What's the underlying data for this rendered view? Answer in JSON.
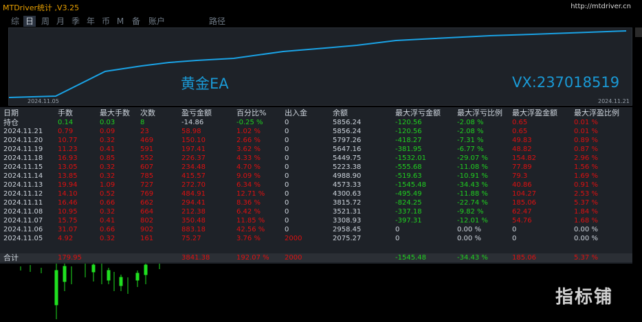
{
  "app": {
    "title": "MTDriver统计 ,V3.25",
    "site": "http://mtdriver.cn"
  },
  "tabs": [
    {
      "label": "综",
      "active": false
    },
    {
      "label": "日",
      "active": true
    },
    {
      "label": "周",
      "active": false
    },
    {
      "label": "月",
      "active": false
    },
    {
      "label": "季",
      "active": false
    },
    {
      "label": "年",
      "active": false
    },
    {
      "label": "币",
      "active": false
    },
    {
      "label": "M",
      "active": false
    },
    {
      "label": "备",
      "active": false
    },
    {
      "label": "账户",
      "active": false
    },
    {
      "label": "路径",
      "active": false
    }
  ],
  "chart": {
    "label_left": "黄金EA",
    "label_right": "VX:237018519",
    "date_start": "2024.11.05",
    "date_end": "2024.11.21",
    "line_color": "#1aa3e6"
  },
  "colors": {
    "header": "#cfd6de",
    "neutral": "#cfd6de",
    "green": "#20d020",
    "red": "#e01010"
  },
  "table": {
    "headers": [
      "日期",
      "手数",
      "最大手数",
      "次数",
      "盈亏金额",
      "百分比%",
      "出入金",
      "余额",
      "最大浮亏金额",
      "最大浮亏比例",
      "最大浮盈金额",
      "最大浮盈比例"
    ],
    "rows": [
      {
        "cells": [
          "持仓",
          "0.14",
          "0.03",
          "8",
          "-14.86",
          "-0.25 %",
          "0",
          "5856.24",
          "-120.56",
          "-2.08 %",
          "0.65",
          "0.01 %"
        ],
        "colors": [
          "h",
          "g",
          "g",
          "g",
          "n",
          "g",
          "n",
          "n",
          "g",
          "g",
          "r",
          "r"
        ]
      },
      {
        "cells": [
          "2024.11.21",
          "0.79",
          "0.09",
          "23",
          "58.98",
          "1.02 %",
          "0",
          "5856.24",
          "-120.56",
          "-2.08 %",
          "0.65",
          "0.01 %"
        ],
        "colors": [
          "n",
          "r",
          "r",
          "r",
          "r",
          "r",
          "n",
          "n",
          "g",
          "g",
          "r",
          "r"
        ]
      },
      {
        "cells": [
          "2024.11.20",
          "10.77",
          "0.32",
          "469",
          "150.10",
          "2.66 %",
          "0",
          "5797.26",
          "-418.27",
          "-7.31 %",
          "49.83",
          "0.89 %"
        ],
        "colors": [
          "n",
          "r",
          "r",
          "r",
          "r",
          "r",
          "n",
          "n",
          "g",
          "g",
          "r",
          "r"
        ]
      },
      {
        "cells": [
          "2024.11.19",
          "11.23",
          "0.41",
          "591",
          "197.41",
          "3.62 %",
          "0",
          "5647.16",
          "-381.95",
          "-6.77 %",
          "48.82",
          "0.87 %"
        ],
        "colors": [
          "n",
          "r",
          "r",
          "r",
          "r",
          "r",
          "n",
          "n",
          "g",
          "g",
          "r",
          "r"
        ]
      },
      {
        "cells": [
          "2024.11.18",
          "16.93",
          "0.85",
          "552",
          "226.37",
          "4.33 %",
          "0",
          "5449.75",
          "-1532.01",
          "-29.07 %",
          "154.82",
          "2.96 %"
        ],
        "colors": [
          "n",
          "r",
          "r",
          "r",
          "r",
          "r",
          "n",
          "n",
          "g",
          "g",
          "r",
          "r"
        ]
      },
      {
        "cells": [
          "2024.11.15",
          "13.05",
          "0.32",
          "607",
          "234.48",
          "4.70 %",
          "0",
          "5223.38",
          "-555.68",
          "-11.08 %",
          "77.89",
          "1.56 %"
        ],
        "colors": [
          "n",
          "r",
          "r",
          "r",
          "r",
          "r",
          "n",
          "n",
          "g",
          "g",
          "r",
          "r"
        ]
      },
      {
        "cells": [
          "2024.11.14",
          "13.85",
          "0.32",
          "785",
          "415.57",
          "9.09 %",
          "0",
          "4988.90",
          "-519.63",
          "-10.91 %",
          "79.3",
          "1.69 %"
        ],
        "colors": [
          "n",
          "r",
          "r",
          "r",
          "r",
          "r",
          "n",
          "n",
          "g",
          "g",
          "r",
          "r"
        ]
      },
      {
        "cells": [
          "2024.11.13",
          "19.94",
          "1.09",
          "727",
          "272.70",
          "6.34 %",
          "0",
          "4573.33",
          "-1545.48",
          "-34.43 %",
          "40.86",
          "0.91 %"
        ],
        "colors": [
          "n",
          "r",
          "r",
          "r",
          "r",
          "r",
          "n",
          "n",
          "g",
          "g",
          "r",
          "r"
        ]
      },
      {
        "cells": [
          "2024.11.12",
          "14.10",
          "0.52",
          "769",
          "484.91",
          "12.71 %",
          "0",
          "4300.63",
          "-495.49",
          "-11.88 %",
          "104.27",
          "2.53 %"
        ],
        "colors": [
          "n",
          "r",
          "r",
          "r",
          "r",
          "r",
          "n",
          "n",
          "g",
          "g",
          "r",
          "r"
        ]
      },
      {
        "cells": [
          "2024.11.11",
          "16.46",
          "0.66",
          "662",
          "294.41",
          "8.36 %",
          "0",
          "3815.72",
          "-824.25",
          "-22.74 %",
          "185.06",
          "5.37 %"
        ],
        "colors": [
          "n",
          "r",
          "r",
          "r",
          "r",
          "r",
          "n",
          "n",
          "g",
          "g",
          "r",
          "r"
        ]
      },
      {
        "cells": [
          "2024.11.08",
          "10.95",
          "0.32",
          "664",
          "212.38",
          "6.42 %",
          "0",
          "3521.31",
          "-337.18",
          "-9.82 %",
          "62.47",
          "1.84 %"
        ],
        "colors": [
          "n",
          "r",
          "r",
          "r",
          "r",
          "r",
          "n",
          "n",
          "g",
          "g",
          "r",
          "r"
        ]
      },
      {
        "cells": [
          "2024.11.07",
          "15.75",
          "0.41",
          "802",
          "350.48",
          "11.85 %",
          "0",
          "3308.93",
          "-397.31",
          "-12.01 %",
          "54.76",
          "1.68 %"
        ],
        "colors": [
          "n",
          "r",
          "r",
          "r",
          "r",
          "r",
          "n",
          "n",
          "g",
          "g",
          "r",
          "r"
        ]
      },
      {
        "cells": [
          "2024.11.06",
          "31.07",
          "0.66",
          "902",
          "883.18",
          "42.56 %",
          "0",
          "2958.45",
          "0",
          "0.00 %",
          "0",
          "0.00 %"
        ],
        "colors": [
          "n",
          "r",
          "r",
          "r",
          "r",
          "r",
          "n",
          "n",
          "n",
          "n",
          "n",
          "n"
        ]
      },
      {
        "cells": [
          "2024.11.05",
          "4.92",
          "0.32",
          "161",
          "75.27",
          "3.76 %",
          "2000",
          "2075.27",
          "0",
          "0.00 %",
          "0",
          "0.00 %"
        ],
        "colors": [
          "n",
          "r",
          "r",
          "r",
          "r",
          "r",
          "r",
          "n",
          "n",
          "n",
          "n",
          "n"
        ]
      }
    ],
    "total": {
      "cells": [
        "合计",
        "179.95",
        "",
        "",
        "3841.38",
        "192.07 %",
        "2000",
        "",
        "-1545.48",
        "-34.43 %",
        "185.06",
        "5.37 %"
      ],
      "colors": [
        "h",
        "r",
        "n",
        "n",
        "r",
        "r",
        "r",
        "n",
        "g",
        "g",
        "r",
        "r"
      ]
    }
  },
  "watermark": "指标铺"
}
